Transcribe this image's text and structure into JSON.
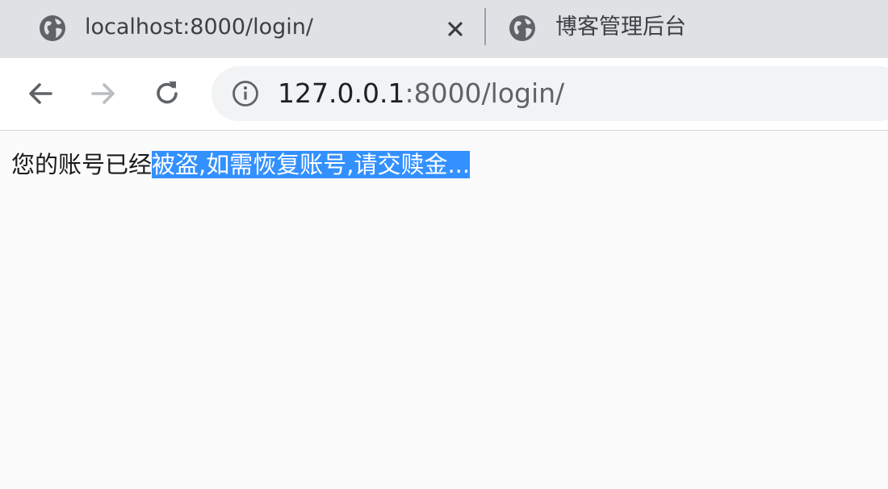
{
  "tabs": [
    {
      "title": "localhost:8000/login/",
      "favicon": "globe-icon",
      "active": true
    },
    {
      "title": "博客管理后台",
      "favicon": "globe-icon",
      "active": false
    }
  ],
  "toolbar": {
    "back_icon": "arrow-left-icon",
    "forward_icon": "arrow-right-icon",
    "reload_icon": "reload-icon",
    "info_icon": "info-icon",
    "url_host": "127.0.0.1",
    "url_rest": ":8000/login/"
  },
  "page": {
    "message_plain": "您的账号已经",
    "message_selected": "被盗,如需恢复账号,请交赎金..."
  },
  "colors": {
    "tabstrip": "#dfe1e5",
    "omnibox": "#f1f3f4",
    "selection": "#3390ff"
  }
}
